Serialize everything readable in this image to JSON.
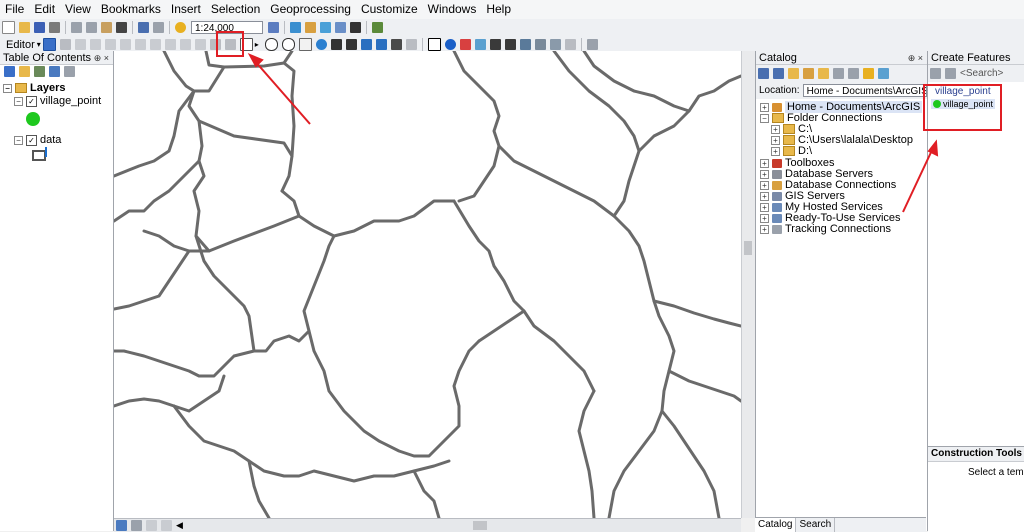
{
  "menu": [
    "File",
    "Edit",
    "View",
    "Bookmarks",
    "Insert",
    "Selection",
    "Geoprocessing",
    "Customize",
    "Windows",
    "Help"
  ],
  "toolbar": {
    "scale": "1:24,000",
    "editor_label": "Editor"
  },
  "toc": {
    "title": "Table Of Contents",
    "layers_label": "Layers",
    "layer1": "village_point",
    "layer2": "data"
  },
  "catalog": {
    "title": "Catalog",
    "location_label": "Location:",
    "location_value": "Home - Documents\\ArcGIS",
    "items": [
      "Home - Documents\\ArcGIS",
      "Folder Connections",
      "C:\\",
      "C:\\Users\\lalala\\Desktop",
      "D:\\",
      "Toolboxes",
      "Database Servers",
      "Database Connections",
      "GIS Servers",
      "My Hosted Services",
      "Ready-To-Use Services",
      "Tracking Connections"
    ],
    "tab_catalog": "Catalog",
    "tab_search": "Search"
  },
  "create_features": {
    "title": "Create Features",
    "search_placeholder": "<Search>",
    "layer_name": "village_point",
    "template_name": "village_point",
    "construction_title": "Construction Tools",
    "construction_hint": "Select a templa"
  },
  "colors": {
    "annotation_red": "#e01e24",
    "point_green": "#1ec81e",
    "boundary_gray": "#6a6a6a"
  }
}
